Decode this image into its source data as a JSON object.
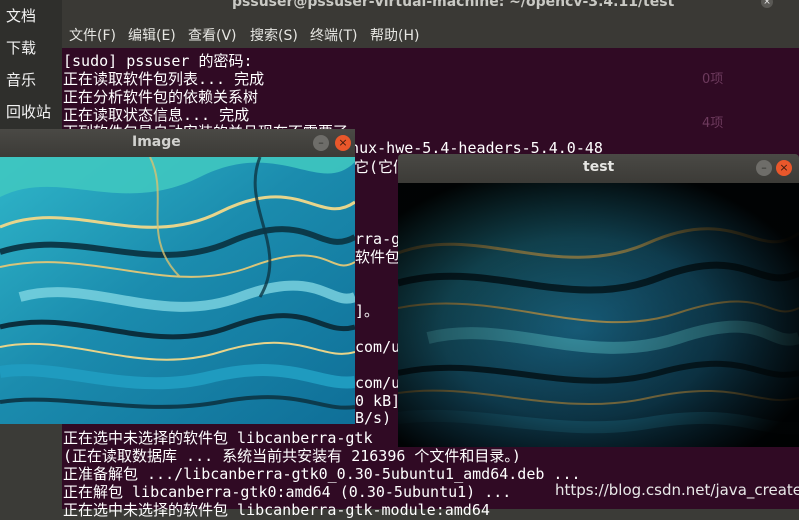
{
  "desktop": {
    "sidebar_items": [
      "文档",
      "下载",
      "音乐",
      "回收站"
    ]
  },
  "terminal": {
    "title": "pssuser@pssuser-virtual-machine: ~/opencv-3.4.11/test",
    "menu": [
      "文件(F)",
      "编辑(E)",
      "查看(V)",
      "搜索(S)",
      "终端(T)",
      "帮助(H)"
    ],
    "lines": [
      "[sudo] pssuser 的密码:",
      "正在读取软件包列表... 完成",
      "正在分析软件包的依赖关系树",
      "正在读取状态信息... 完成",
      "下列软件包是自动安装的并且现在不需要了:",
      "  linux-hwe-5.4-headers-5.4.0-48",
      "它(它们",
      "rra-g",
      "软件包",
      "]。",
      "com/ub",
      "com/ub",
      "0 kB]",
      "B/s)",
      "正在选中未选择的软件包 libcanberra-gtk",
      "(正在读取数据库 ... 系统当前共安装有 216396 个文件和目录。)",
      "正准备解包 .../libcanberra-gtk0_0.30-5ubuntu1_amd64.deb  ...",
      "正在解包 libcanberra-gtk0:amd64 (0.30-5ubuntu1) ...",
      "正在选中未选择的软件包 libcanberra-gtk-module:amd64"
    ],
    "faint_right": [
      "0项",
      "4项"
    ]
  },
  "image_window": {
    "title": "Image",
    "min_glyph": "–",
    "close_glyph": "×"
  },
  "test_window": {
    "title": "test",
    "min_glyph": "–",
    "close_glyph": "×"
  },
  "watermark": "https://blog.csdn.net/java_creater",
  "colors": {
    "terminal_bg": "#300a24",
    "titlebar": "#3c3b37",
    "close_button": "#e9572b"
  }
}
